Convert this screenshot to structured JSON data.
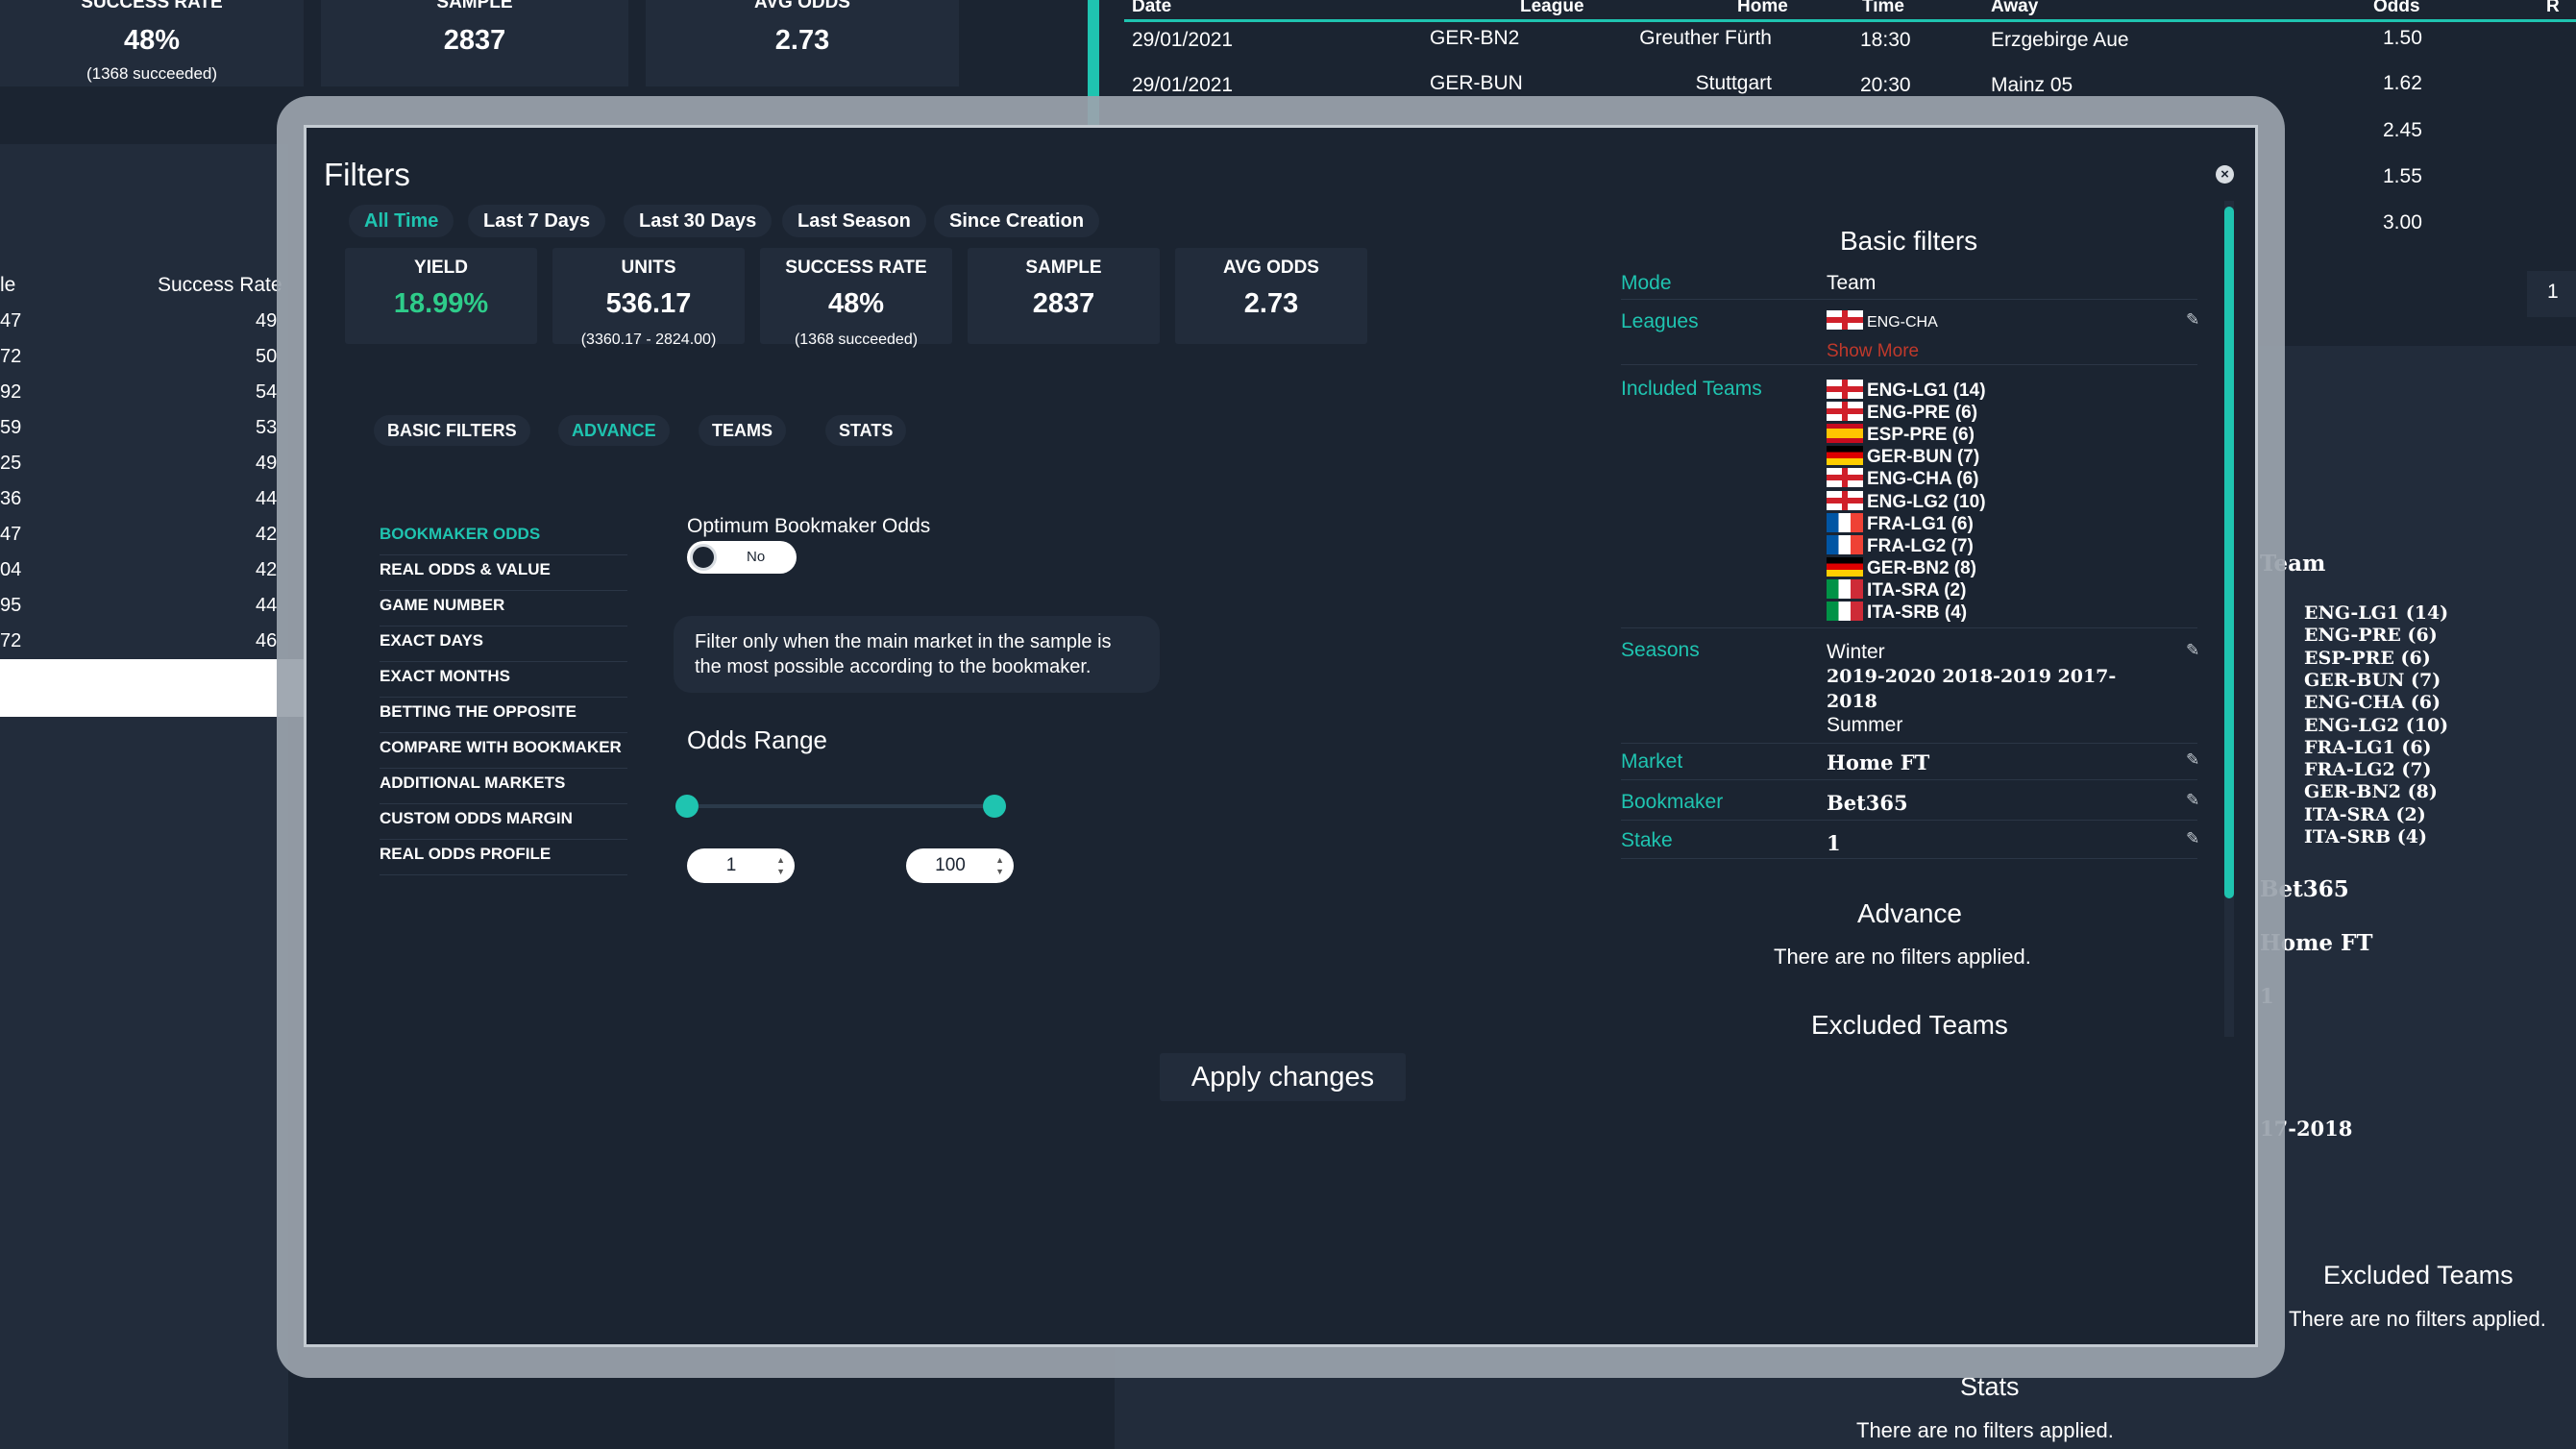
{
  "background": {
    "stats": [
      {
        "label": "SUCCESS RATE",
        "value": "48%",
        "sub": "(1368 succeeded)"
      },
      {
        "label": "SAMPLE",
        "value": "2837"
      },
      {
        "label": "AVG ODDS",
        "value": "2.73"
      }
    ],
    "left_table": {
      "col_a": "le",
      "col_b": "Success Rate",
      "rows": [
        [
          "47",
          "49"
        ],
        [
          "72",
          "50"
        ],
        [
          "92",
          "54"
        ],
        [
          "59",
          "53"
        ],
        [
          "25",
          "49"
        ],
        [
          "36",
          "44"
        ],
        [
          "47",
          "42"
        ],
        [
          "04",
          "42"
        ],
        [
          "95",
          "44"
        ],
        [
          "72",
          "46"
        ]
      ]
    },
    "matches": {
      "headers": [
        "Date",
        "League",
        "Home",
        "Time",
        "Away",
        "Odds",
        "R"
      ],
      "rows": [
        {
          "date": "29/01/2021",
          "league": "GER-BN2",
          "home": "Greuther Fürth",
          "time": "18:30",
          "away": "Erzgebirge Aue",
          "odds": "1.50"
        },
        {
          "date": "29/01/2021",
          "league": "GER-BUN",
          "home": "Stuttgart",
          "time": "20:30",
          "away": "Mainz 05",
          "odds": "1.62"
        }
      ],
      "extra_odds": [
        "2.45",
        "1.55",
        "3.00"
      ],
      "page": "1"
    },
    "right_summary": {
      "team_header": "Team",
      "teams": [
        "ENG-LG1 (14)",
        "ENG-PRE (6)",
        "ESP-PRE (6)",
        "GER-BUN (7)",
        "ENG-CHA (6)",
        "ENG-LG2 (10)",
        "FRA-LG1 (6)",
        "FRA-LG2 (7)",
        "GER-BN2 (8)",
        "ITA-SRA (2)",
        "ITA-SRB (4)"
      ],
      "bookmaker": "Bet365",
      "market": "Home FT",
      "stake": "1",
      "season": "17-2018",
      "excluded_title": "Excluded Teams",
      "excluded_note": "There are no filters applied.",
      "stats_title": "Stats",
      "stats_note": "There are no filters applied."
    }
  },
  "modal": {
    "title": "Filters",
    "close_label": "×",
    "periods": [
      {
        "label": "All Time",
        "active": true
      },
      {
        "label": "Last 7 Days"
      },
      {
        "label": "Last 30 Days"
      },
      {
        "label": "Last Season"
      },
      {
        "label": "Since Creation"
      }
    ],
    "stats": [
      {
        "label": "YIELD",
        "value": "18.99%",
        "sub": ""
      },
      {
        "label": "UNITS",
        "value": "536.17",
        "sub": "(3360.17 - 2824.00)"
      },
      {
        "label": "SUCCESS RATE",
        "value": "48%",
        "sub": "(1368 succeeded)"
      },
      {
        "label": "SAMPLE",
        "value": "2837",
        "sub": ""
      },
      {
        "label": "AVG ODDS",
        "value": "2.73",
        "sub": ""
      }
    ],
    "tabs": [
      "BASIC FILTERS",
      "ADVANCE",
      "TEAMS",
      "STATS"
    ],
    "advance_menu": [
      "BOOKMAKER ODDS",
      "REAL ODDS & VALUE",
      "GAME NUMBER",
      "EXACT DAYS",
      "EXACT MONTHS",
      "BETTING THE OPPOSITE",
      "COMPARE WITH BOOKMAKER",
      "ADDITIONAL MARKETS",
      "CUSTOM ODDS MARGIN",
      "REAL ODDS PROFILE"
    ],
    "optimum": {
      "label": "Optimum Bookmaker Odds",
      "toggle_text": "No",
      "enabled": false,
      "note_line1": "Filter only when the main market in the sample is",
      "note_line2": "the most possible according to the bookmaker."
    },
    "odds_range": {
      "label": "Odds Range",
      "min": "1",
      "max": "100",
      "selected_min": 1,
      "selected_max": 100
    },
    "apply_label": "Apply changes",
    "summary": {
      "basic_title": "Basic filters",
      "mode_label": "Mode",
      "mode_value": "Team",
      "leagues_label": "Leagues",
      "leagues_value": "ENG-CHA",
      "show_more": "Show More",
      "included_label": "Included Teams",
      "included_teams": [
        {
          "flag": "eng",
          "text": "ENG-LG1 (14)"
        },
        {
          "flag": "eng",
          "text": "ENG-PRE (6)"
        },
        {
          "flag": "esp",
          "text": "ESP-PRE (6)"
        },
        {
          "flag": "ger",
          "text": "GER-BUN (7)"
        },
        {
          "flag": "eng",
          "text": "ENG-CHA (6)"
        },
        {
          "flag": "eng",
          "text": "ENG-LG2 (10)"
        },
        {
          "flag": "fra",
          "text": "FRA-LG1 (6)"
        },
        {
          "flag": "fra",
          "text": "FRA-LG2 (7)"
        },
        {
          "flag": "ger",
          "text": "GER-BN2 (8)"
        },
        {
          "flag": "ita",
          "text": "ITA-SRA (2)"
        },
        {
          "flag": "ita",
          "text": "ITA-SRB (4)"
        }
      ],
      "seasons_label": "Seasons",
      "seasons_line1": "Winter",
      "seasons_line2": "2019-2020 2018-2019 2017-",
      "seasons_line3": "2018",
      "seasons_line4": "Summer",
      "market_label": "Market",
      "market_value": "Home FT",
      "bookmaker_label": "Bookmaker",
      "bookmaker_value": "Bet365",
      "stake_label": "Stake",
      "stake_value": "1",
      "advance_title": "Advance",
      "advance_note": "There are no filters applied.",
      "excluded_title": "Excluded Teams"
    },
    "colors": {
      "accent": "#1fc4b0",
      "yield": "#2ecc8a",
      "show_more": "#c0392b"
    }
  }
}
